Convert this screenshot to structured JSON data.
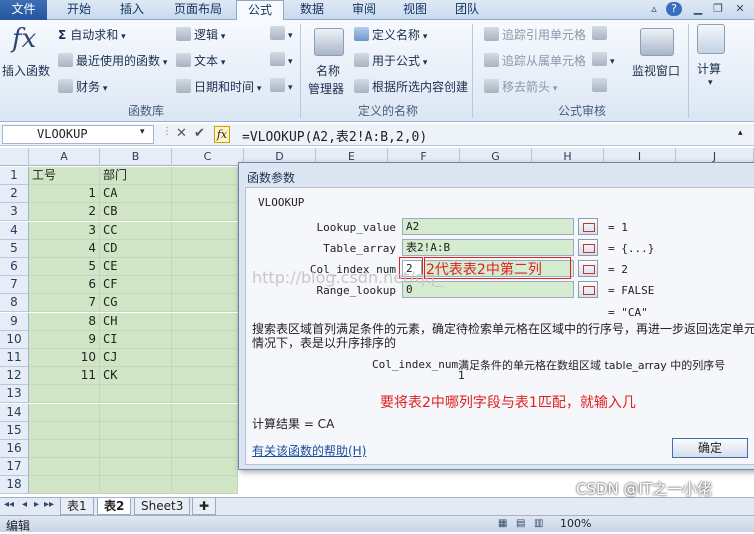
{
  "tabs": [
    "文件",
    "开始",
    "插入",
    "页面布局",
    "公式",
    "数据",
    "审阅",
    "视图",
    "团队"
  ],
  "ribbon": {
    "insert_function": "插入函数",
    "autosum": "自动求和",
    "recent": "最近使用的函数",
    "financial": "财务",
    "logical": "逻辑",
    "text": "文本",
    "datetime": "日期和时间",
    "name_manager_1": "名称",
    "name_manager_2": "管理器",
    "define_name": "定义名称",
    "use_in_formula": "用于公式",
    "create_from_sel": "根据所选内容创建",
    "trace_precedents": "追踪引用单元格",
    "trace_dependents": "追踪从属单元格",
    "remove_arrows": "移去箭头",
    "watch_window": "监视窗口",
    "calculate": "计算",
    "group_library": "函数库",
    "group_names": "定义的名称",
    "group_audit": "公式审核"
  },
  "formula_bar": {
    "name_box": "VLOOKUP",
    "formula": "=VLOOKUP(A2,表2!A:B,2,0)"
  },
  "columns": [
    "A",
    "B",
    "C",
    "D",
    "E",
    "F",
    "G",
    "H",
    "I",
    "J"
  ],
  "rows": [
    "1",
    "2",
    "3",
    "4",
    "5",
    "6",
    "7",
    "8",
    "9",
    "10",
    "11",
    "12",
    "13",
    "14",
    "15",
    "16",
    "17",
    "18"
  ],
  "sheet": {
    "header_a": "工号",
    "header_b": "部门",
    "data": [
      {
        "a": "1",
        "b": "CA"
      },
      {
        "a": "2",
        "b": "CB"
      },
      {
        "a": "3",
        "b": "CC"
      },
      {
        "a": "4",
        "b": "CD"
      },
      {
        "a": "5",
        "b": "CE"
      },
      {
        "a": "6",
        "b": "CF"
      },
      {
        "a": "7",
        "b": "CG"
      },
      {
        "a": "8",
        "b": "CH"
      },
      {
        "a": "9",
        "b": "CI"
      },
      {
        "a": "10",
        "b": "CJ"
      },
      {
        "a": "11",
        "b": "CK"
      }
    ]
  },
  "sheet_tabs": [
    "表1",
    "表2",
    "Sheet3"
  ],
  "status": "编辑",
  "zoom": "100%",
  "dialog": {
    "title": "函数参数",
    "func": "VLOOKUP",
    "args": [
      {
        "label": "Lookup_value",
        "value": "A2",
        "result": "= 1"
      },
      {
        "label": "Table_array",
        "value": "表2!A:B",
        "result": "= {...}"
      },
      {
        "label": "Col_index_num",
        "value": "2",
        "result": "= 2"
      },
      {
        "label": "Range_lookup",
        "value": "0",
        "result": "= FALSE"
      }
    ],
    "overall": "= \"CA\"",
    "desc1": "搜索表区域首列满足条件的元素，确定待检索单元格在区域中的行序号，再进一步返回选定单元",
    "desc2": "情况下，表是以升序排序的",
    "arg_name": "Col_index_num",
    "arg_desc1": "满足条件的单元格在数组区域 table_array 中的列序号",
    "arg_desc2": "1",
    "annotation_inline": "2代表表2中第二列",
    "annotation_main": "要将表2中哪列字段与表1匹配，就输入几",
    "calc_result": "计算结果 = CA",
    "help": "有关该函数的帮助(H)",
    "ok": "确定"
  },
  "watermark": "http://blog.csdn.net/qq_",
  "csdn": "CSDN @IT之一小佬"
}
